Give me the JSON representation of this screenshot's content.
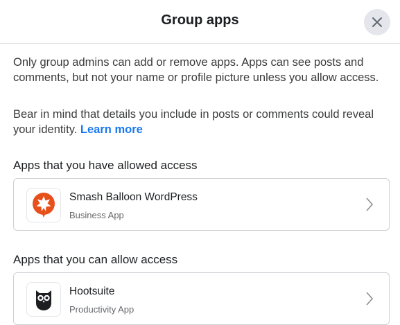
{
  "header": {
    "title": "Group apps"
  },
  "intro": {
    "p1": "Only group admins can add or remove apps. Apps can see posts and comments, but not your name or profile picture unless you allow access.",
    "p2": "Bear in mind that details you include in posts or comments could reveal your identity.",
    "link": "Learn more"
  },
  "sections": [
    {
      "title": "Apps that you have allowed access",
      "apps": [
        {
          "name": "Smash Balloon WordPress",
          "type": "Business App",
          "icon": "smash-balloon-logo-icon"
        }
      ]
    },
    {
      "title": "Apps that you can allow access",
      "apps": [
        {
          "name": "Hootsuite",
          "type": "Productivity App",
          "icon": "hootsuite-owl-logo-icon"
        }
      ]
    }
  ],
  "colors": {
    "link": "#1877f2",
    "smash_balloon": "#e8501b",
    "divider": "#dadde1"
  }
}
